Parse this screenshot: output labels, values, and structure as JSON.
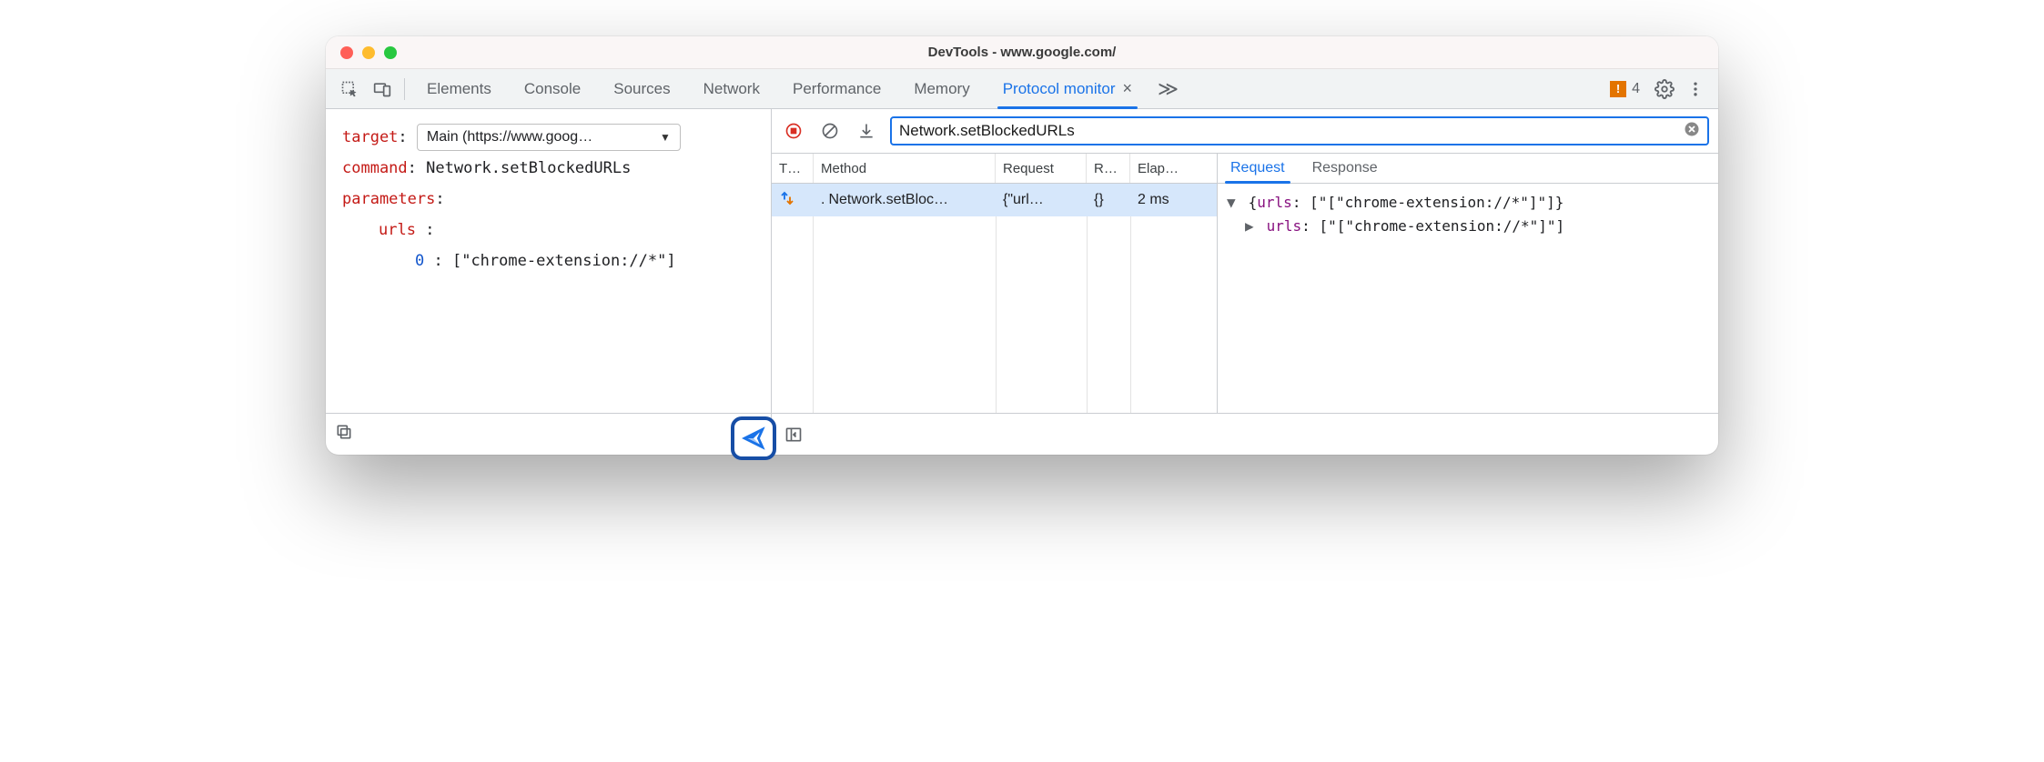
{
  "window": {
    "title": "DevTools - www.google.com/"
  },
  "tabs": {
    "items": [
      "Elements",
      "Console",
      "Sources",
      "Network",
      "Performance",
      "Memory",
      "Protocol monitor"
    ],
    "active": "Protocol monitor",
    "warnings_count": "4"
  },
  "editor": {
    "target_label": "target",
    "target_value": "Main (https://www.goog…",
    "command_label": "command",
    "command_value": "Network.setBlockedURLs",
    "parameters_label": "parameters",
    "urls_label": "urls",
    "index0_label": "0",
    "index0_value": "[\"chrome-extension://*\"]"
  },
  "filter": {
    "value": "Network.setBlockedURLs"
  },
  "log": {
    "columns": {
      "type": "T…",
      "method": "Method",
      "request": "Request",
      "response": "R…",
      "elapsed": "Elap…"
    },
    "rows": [
      {
        "method": "Network.setBloc…",
        "request": "{\"url…",
        "response": "{}",
        "elapsed": "2 ms"
      }
    ]
  },
  "details": {
    "tabs": {
      "request": "Request",
      "response": "Response",
      "active": "Request"
    },
    "line1_prop": "urls",
    "line1_val": "[\"[\"chrome-extension://*\"]\"]",
    "line2_prop": "urls",
    "line2_val": "[\"[\"chrome-extension://*\"]\"]"
  }
}
